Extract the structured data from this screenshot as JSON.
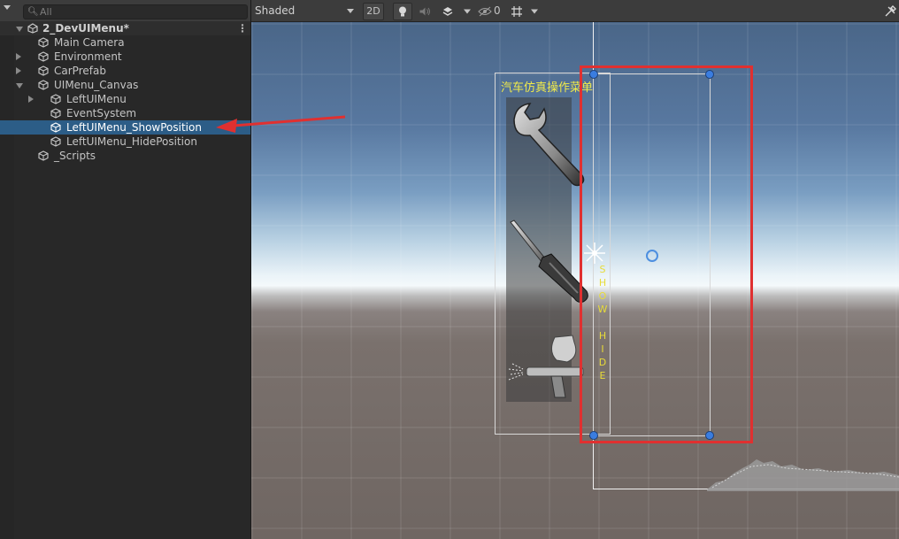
{
  "hierarchy": {
    "search_placeholder": "All",
    "scene": {
      "name": "2_DevUIMenu*"
    },
    "items": [
      {
        "label": "Main Camera",
        "indent": 0,
        "fold": "none",
        "selected": false
      },
      {
        "label": "Environment",
        "indent": 0,
        "fold": "closed",
        "selected": false
      },
      {
        "label": "CarPrefab",
        "indent": 0,
        "fold": "closed",
        "selected": false
      },
      {
        "label": "UIMenu_Canvas",
        "indent": 0,
        "fold": "open",
        "selected": false
      },
      {
        "label": "LeftUIMenu",
        "indent": 1,
        "fold": "closed",
        "selected": false
      },
      {
        "label": "EventSystem",
        "indent": 1,
        "fold": "none",
        "selected": false
      },
      {
        "label": "LeftUIMenu_ShowPosition",
        "indent": 1,
        "fold": "none",
        "selected": true
      },
      {
        "label": "LeftUIMenu_HidePosition",
        "indent": 1,
        "fold": "none",
        "selected": false
      },
      {
        "label": "_Scripts",
        "indent": 0,
        "fold": "none",
        "selected": false
      }
    ]
  },
  "scene_toolbar": {
    "shading_mode": "Shaded",
    "mode_2d_label": "2D",
    "hidden_count": "0",
    "icons": [
      "lightbulb-icon",
      "audio-icon",
      "effects-icon",
      "visibility-icon",
      "grid-icon",
      "gizmos-icon"
    ]
  },
  "scene": {
    "menu_title": "汽车仿真操作菜单",
    "toggle_letters": [
      "S",
      "H",
      "O",
      "W",
      "",
      "H",
      "I",
      "D",
      "E"
    ],
    "tools": [
      "wrench-icon",
      "screwdriver-icon",
      "spray-gun-icon"
    ]
  },
  "colors": {
    "selection": "#2c5d87",
    "annotation_red": "#e03030",
    "menu_title_yellow": "#f0ea4a",
    "handle_blue": "#3a7de0"
  }
}
